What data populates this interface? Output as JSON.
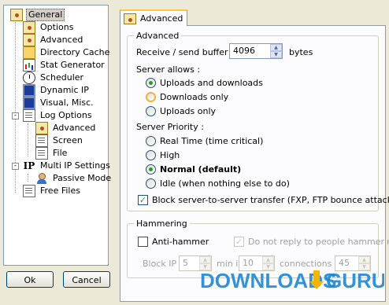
{
  "tree": {
    "items": [
      {
        "label": "General",
        "icon": "settings-icon",
        "selected": true
      },
      {
        "label": "Options",
        "icon": "options-icon"
      },
      {
        "label": "Advanced",
        "icon": "advanced-icon"
      },
      {
        "label": "Directory Cache",
        "icon": "folder-icon"
      },
      {
        "label": "Stat Generator",
        "icon": "stats-icon"
      },
      {
        "label": "Scheduler",
        "icon": "clock-icon"
      },
      {
        "label": "Dynamic IP",
        "icon": "network-icon"
      },
      {
        "label": "Visual, Misc.",
        "icon": "screen-icon"
      },
      {
        "label": "Log Options",
        "icon": "log-icon",
        "expander": "-"
      },
      {
        "label": "Advanced",
        "icon": "advanced-icon"
      },
      {
        "label": "Screen",
        "icon": "document-icon"
      },
      {
        "label": "File",
        "icon": "document-icon"
      },
      {
        "label": "Multi IP Settings",
        "icon": "ip-icon",
        "glyph": "IP",
        "expander": "-"
      },
      {
        "label": "Passive Mode",
        "icon": "user-icon"
      },
      {
        "label": "Free Files",
        "icon": "document-icon"
      }
    ]
  },
  "buttons": {
    "ok": "Ok",
    "cancel": "Cancel"
  },
  "tab": {
    "label": "Advanced"
  },
  "advanced": {
    "title": "Advanced",
    "buffer_label": "Receive / send buffer :",
    "buffer_value": "4096",
    "buffer_unit": "bytes",
    "server_allows_label": "Server allows :",
    "allow_options": [
      "Uploads and downloads",
      "Downloads only",
      "Uploads only"
    ],
    "allow_selected": 0,
    "priority_label": "Server Priority :",
    "priority_options": [
      "Real Time (time critical)",
      "High",
      "Normal (default)",
      "Idle (when nothing else to do)"
    ],
    "priority_selected": 2,
    "block_label": "Block server-to-server transfer (FXP, FTP bounce attack)",
    "block_checked": true
  },
  "hammering": {
    "title": "Hammering",
    "anti_hammer_label": "Anti-hammer",
    "anti_hammer_checked": false,
    "no_reply_label": "Do not reply to people hammering",
    "no_reply_checked": true,
    "block_ip_label": "Block IP",
    "block_ip_value": "5",
    "min_if_label": "min if",
    "min_if_value": "10",
    "connections_label": "connections in",
    "connections_value": "45"
  },
  "watermark": {
    "text_a": "DOWNLOADS",
    "text_b": "GURU"
  },
  "colors": {
    "accent": "#ffc83c",
    "selected_radio": "#21a121",
    "watermark": "#1f87d0"
  }
}
